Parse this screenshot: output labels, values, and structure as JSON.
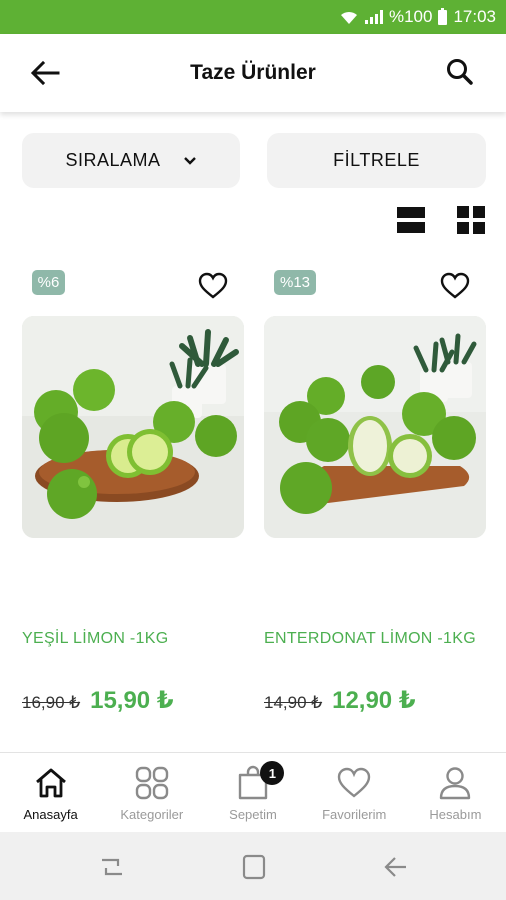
{
  "status_bar": {
    "battery": "%100",
    "time": "17:03"
  },
  "header": {
    "title": "Taze Ürünler",
    "back_icon": "arrow-left-icon",
    "search_icon": "search-icon"
  },
  "controls": {
    "sort_label": "SIRALAMA",
    "filter_label": "FİLTRELE"
  },
  "products": [
    {
      "badge": "%6",
      "name": "YEŞİL LİMON -1KG",
      "old_price": "16,90 ₺",
      "new_price": "15,90 ₺"
    },
    {
      "badge": "%13",
      "name": "ENTERDONAT LİMON -1KG",
      "old_price": "14,90 ₺",
      "new_price": "12,90 ₺"
    }
  ],
  "tabs": [
    {
      "label": "Anasayfa",
      "icon": "home-icon",
      "active": true
    },
    {
      "label": "Kategoriler",
      "icon": "categories-icon",
      "active": false
    },
    {
      "label": "Sepetim",
      "icon": "cart-icon",
      "active": false,
      "badge": "1"
    },
    {
      "label": "Favorilerim",
      "icon": "heart-icon",
      "active": false
    },
    {
      "label": "Hesabım",
      "icon": "user-icon",
      "active": false
    }
  ],
  "colors": {
    "brand_green": "#5eb134",
    "price_green": "#4caf50",
    "badge_bg": "#8fb8a9"
  }
}
